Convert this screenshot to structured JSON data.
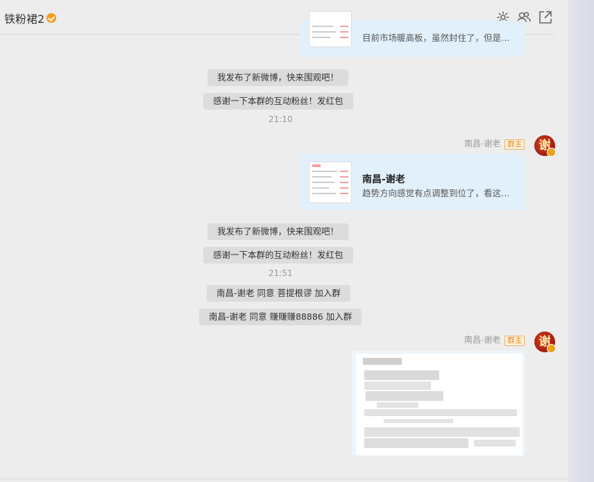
{
  "header": {
    "title": "铁粉裙2"
  },
  "messages": {
    "top_card_desc": "目前市场暖高板，虽然封住了，但是空...",
    "sys1": "我发布了新微博，快来围观吧！",
    "sys2": "感谢一下本群的互动粉丝！发红包",
    "time1": "21:10",
    "sender1": "南昌-谢老",
    "owner_badge": "群主",
    "card_title": "南昌-谢老",
    "card_desc": "趋势方向感觉有点调整到位了，看这波...",
    "sys3": "我发布了新微博，快来围观吧！",
    "sys4": "感谢一下本群的互动粉丝！发红包",
    "time2": "21:51",
    "join1": "南昌-谢老 同意 菩提根谬 加入群",
    "join2": "南昌-谢老 同意 赚赚赚88886 加入群",
    "sender2": "南昌-谢老",
    "avatar_char": "谢"
  }
}
